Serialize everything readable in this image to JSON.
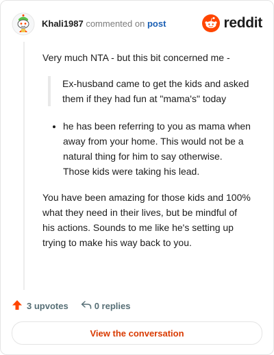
{
  "header": {
    "username": "Khali1987",
    "commented_text": "commented on",
    "post_link": "post",
    "brand_wordmark": "reddit",
    "avatar_icon": "snoo-avatar-icon",
    "brand_icon": "reddit-logo-icon"
  },
  "comment": {
    "intro": "Very much NTA - but this bit concerned me -",
    "quote": "Ex-husband came to get the kids and asked them if they had fun at \"mama's\" today",
    "bullets": [
      "he has been referring to you as mama when away from your home. This would not be a natural thing for him to say otherwise. Those kids were taking his lead."
    ],
    "closing": "You have been amazing for those kids and 100% what they need in their lives, but be mindful of his actions. Sounds to me like he's setting up trying to make his way back to you."
  },
  "footer": {
    "upvotes": "3 upvotes",
    "replies": "0 replies",
    "upvote_icon": "upvote-arrow-icon",
    "reply_icon": "reply-arrow-icon"
  },
  "cta": {
    "label": "View the conversation"
  },
  "colors": {
    "accent": "#ff4500",
    "link": "#1a5fb4",
    "cta_text": "#d93a00",
    "muted": "#576f76"
  }
}
